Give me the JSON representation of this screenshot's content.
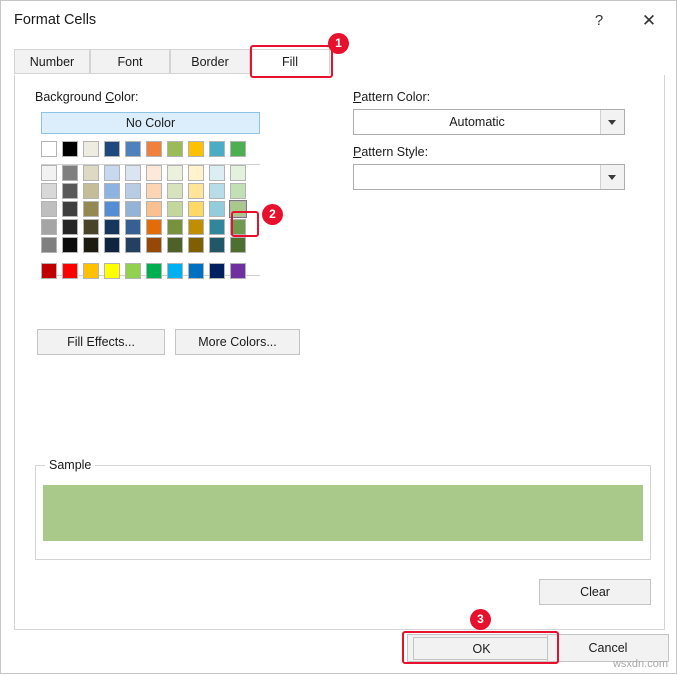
{
  "window": {
    "title": "Format Cells",
    "help_icon": "?",
    "close_icon": "✕"
  },
  "tabs": [
    {
      "label": "Number",
      "selected": false
    },
    {
      "label": "Font",
      "selected": false
    },
    {
      "label": "Border",
      "selected": false
    },
    {
      "label": "Fill",
      "selected": true
    }
  ],
  "fill_tab": {
    "background_color_label": "Background Color:",
    "no_color_button": "No Color",
    "pattern_color_label": "Pattern Color:",
    "pattern_color_value": "Automatic",
    "pattern_style_label": "Pattern Style:",
    "pattern_style_value": "",
    "fill_effects_button": "Fill Effects...",
    "more_colors_button": "More Colors...",
    "clear_button": "Clear",
    "sample_group_label": "Sample",
    "sample_fill_color": "#a9c98b",
    "selected_swatch_color": "#a9c98b",
    "palette": {
      "theme_row": [
        "#ffffff",
        "#000000",
        "#eeece1",
        "#1f497d",
        "#4f81bd",
        "#f0803c",
        "#9bbb59",
        "#ffc000",
        "#4bacc6",
        "#4cb050"
      ],
      "tint_rows": [
        [
          "#f2f2f2",
          "#7f7f7f",
          "#ddd9c3",
          "#c6d9f0",
          "#dbe5f1",
          "#fde9d9",
          "#ebf1dd",
          "#fff2cc",
          "#dbeef3",
          "#e5f1df"
        ],
        [
          "#d8d8d8",
          "#595959",
          "#c4bd97",
          "#8db3e2",
          "#b8cce4",
          "#fcd5b4",
          "#d7e3bc",
          "#ffe599",
          "#b7dde8",
          "#c3e0b4"
        ],
        [
          "#bfbfbf",
          "#3f3f3f",
          "#938953",
          "#548dd4",
          "#95b3d7",
          "#fac08f",
          "#c3d69b",
          "#ffd966",
          "#93cddc",
          "#a9c98b"
        ],
        [
          "#a5a5a5",
          "#262626",
          "#494429",
          "#17365d",
          "#366092",
          "#e36c09",
          "#76923c",
          "#bf8f00",
          "#31869b",
          "#6f9b4e"
        ],
        [
          "#7f7f7f",
          "#0c0c0c",
          "#1d1b10",
          "#0f243e",
          "#244061",
          "#974806",
          "#4f6128",
          "#7f6000",
          "#205867",
          "#4d7030"
        ]
      ],
      "standard_row": [
        "#c00000",
        "#ff0000",
        "#ffc000",
        "#ffff00",
        "#92d050",
        "#00b050",
        "#00b0f0",
        "#0070c0",
        "#002060",
        "#7030a0"
      ]
    }
  },
  "footer": {
    "ok_button": "OK",
    "cancel_button": "Cancel"
  },
  "annotations": [
    {
      "id": "1",
      "target": "tab-fill"
    },
    {
      "id": "2",
      "target": "palette-swatch-selected"
    },
    {
      "id": "3",
      "target": "ok-button"
    }
  ],
  "watermark": "wsxdn.com"
}
